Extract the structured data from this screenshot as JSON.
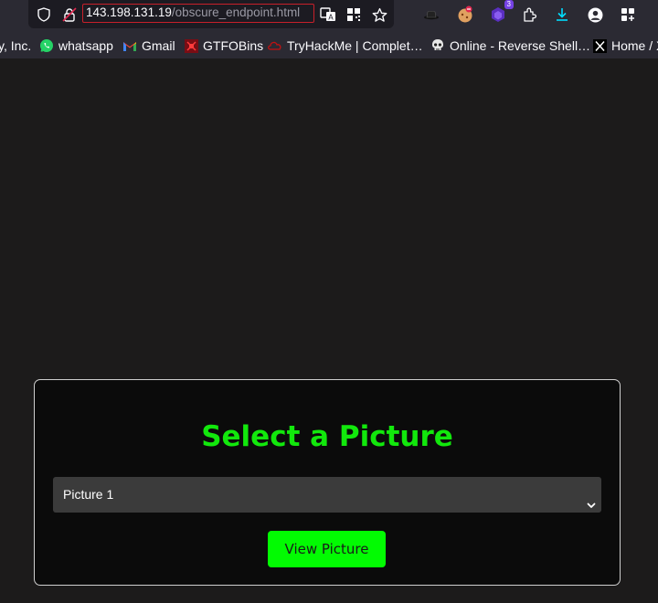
{
  "browser": {
    "url_host": "143.198.131.19",
    "url_path": "/obscure_endpoint.html",
    "extension_badge": "3"
  },
  "bookmarks": [
    {
      "label": "y, Inc.",
      "icon": "none"
    },
    {
      "label": "whatsapp",
      "icon": "whatsapp-icon"
    },
    {
      "label": "Gmail",
      "icon": "gmail-icon"
    },
    {
      "label": "GTFOBins",
      "icon": "gtfobins-icon"
    },
    {
      "label": "TryHackMe | Complet…",
      "icon": "tryhackme-icon"
    },
    {
      "label": "Online - Reverse Shell…",
      "icon": "skull-icon"
    },
    {
      "label": "Home / X",
      "icon": "x-icon"
    }
  ],
  "page": {
    "title": "Select a Picture",
    "select_value": "Picture 1",
    "button_label": "View Picture",
    "colors": {
      "accent_green": "#02fb02",
      "title_green": "#12e80c",
      "card_bg": "#0b0b0b",
      "page_bg": "#1c1b1b"
    }
  }
}
